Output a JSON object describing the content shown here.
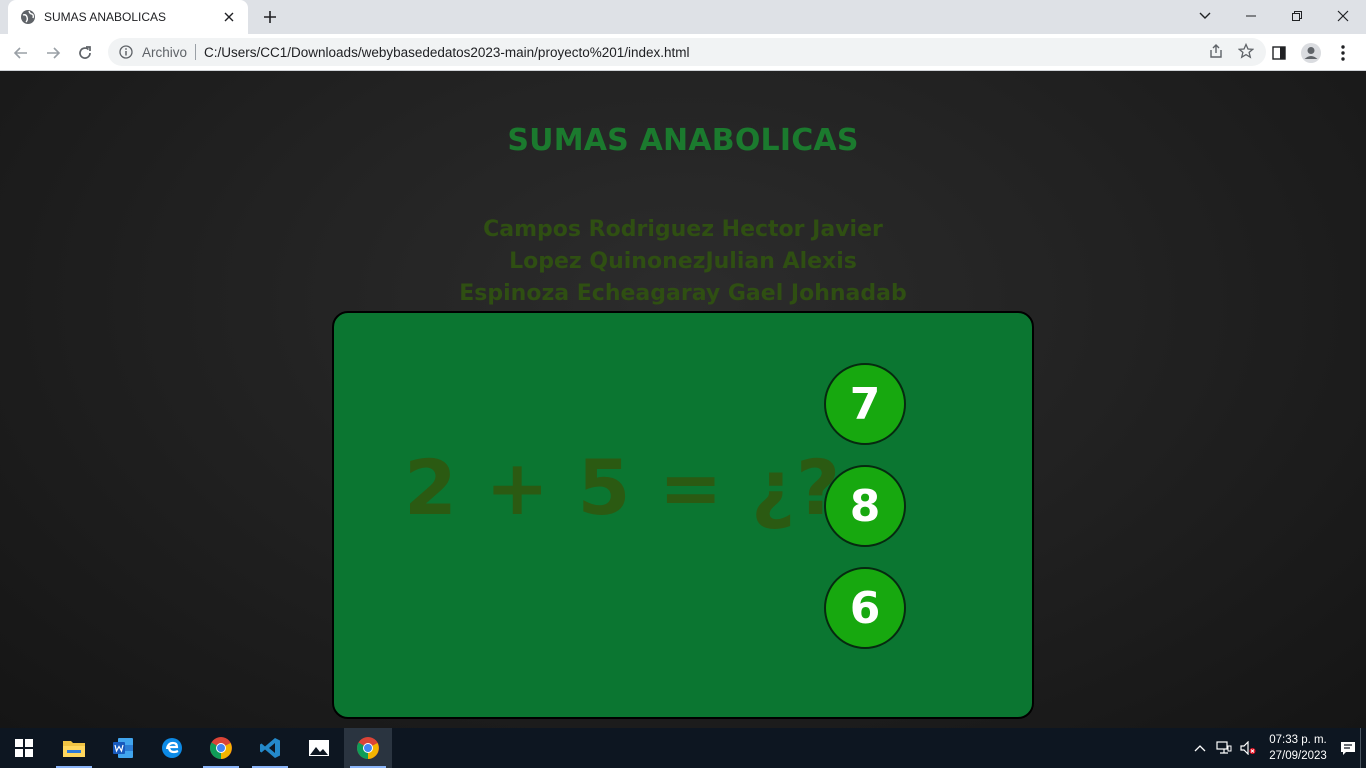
{
  "browser": {
    "tab_title": "SUMAS ANABOLICAS",
    "omnibox": {
      "scheme_label": "Archivo",
      "url": "C:/Users/CC1/Downloads/webybasededatos2023-main/proyecto%201/index.html"
    }
  },
  "page": {
    "title": "SUMAS ANABOLICAS",
    "authors": [
      "Campos Rodriguez Hector Javier",
      "Lopez QuinonezJulian Alexis",
      "Espinoza Echeagaray Gael Johnadab"
    ],
    "question": {
      "equation": "2 + 5 = ¿?",
      "options": [
        "7",
        "8",
        "6"
      ]
    },
    "colors": {
      "title": "#1b7a2e",
      "authors": "#2f4f12",
      "card_bg": "#0b7631",
      "equation": "#2b5a12",
      "option_bg": "#17a80f"
    }
  },
  "taskbar": {
    "apps": [
      "start-icon",
      "file-explorer-icon",
      "word-icon",
      "edge-icon",
      "chrome-icon",
      "vscode-icon",
      "photos-icon",
      "chrome-active-icon"
    ],
    "clock": {
      "time": "07:33 p. m.",
      "date": "27/09/2023"
    }
  }
}
